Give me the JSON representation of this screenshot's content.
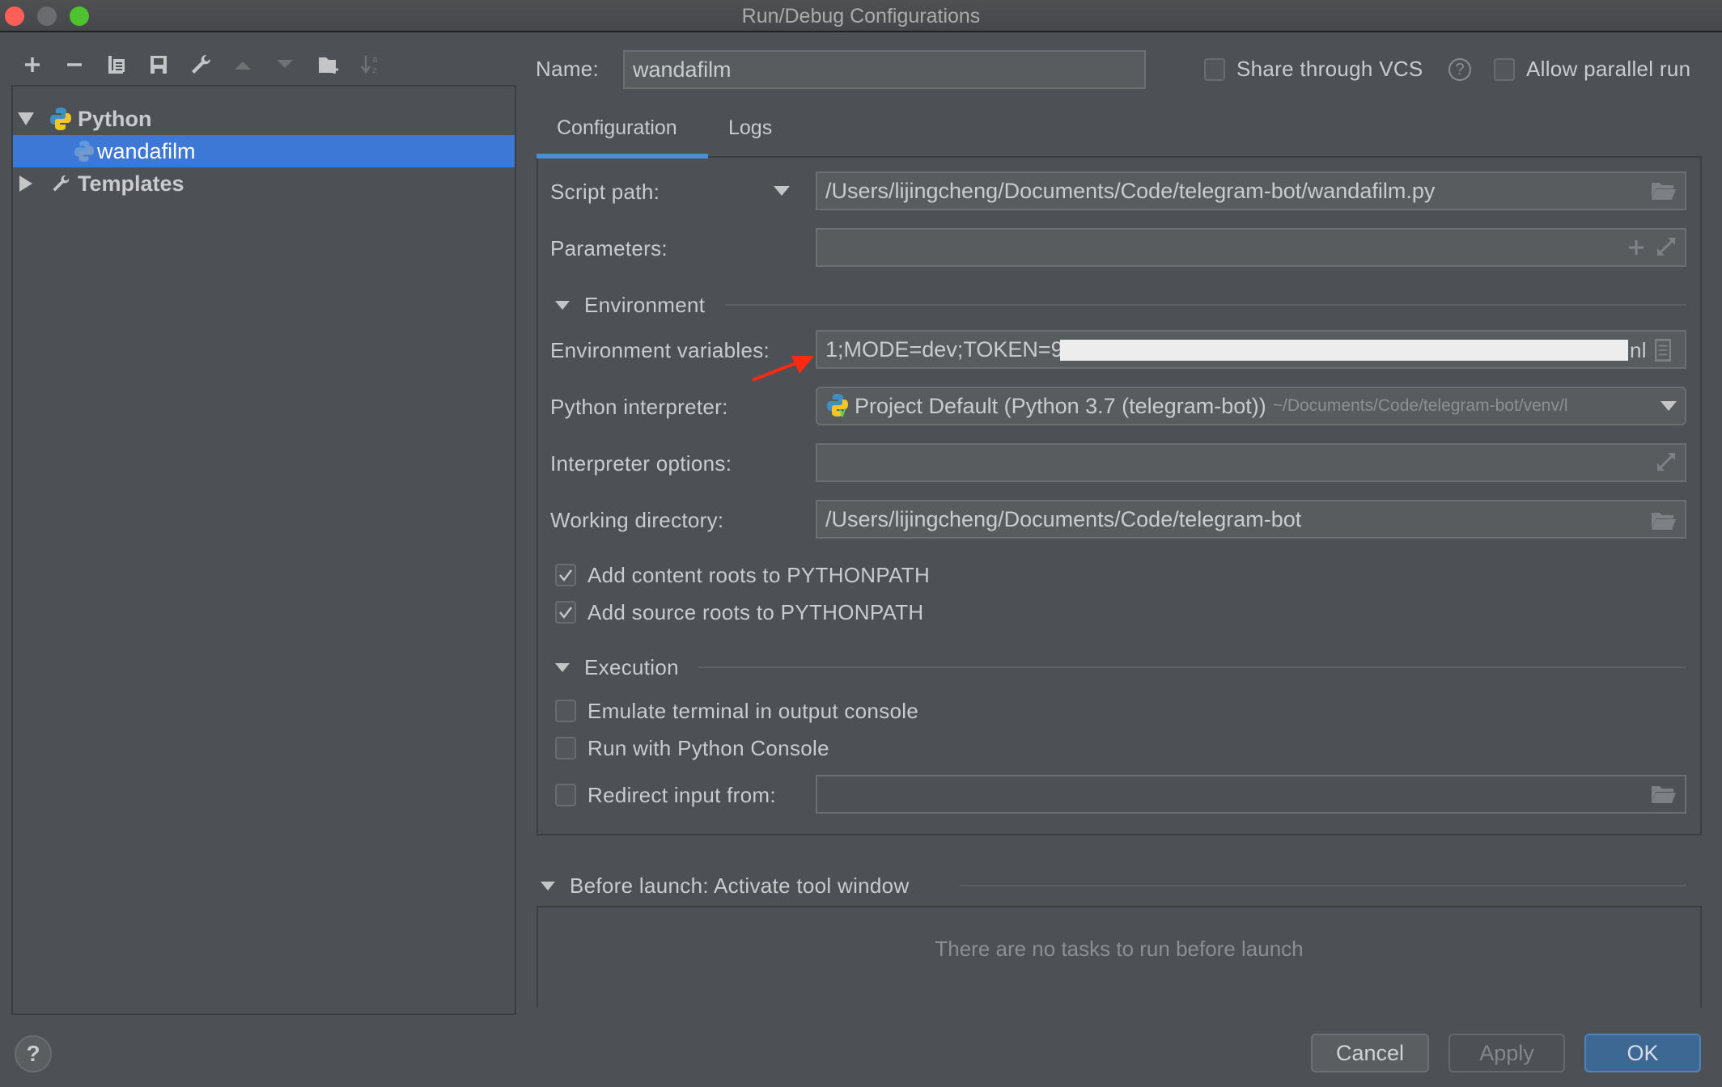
{
  "window": {
    "title": "Run/Debug Configurations",
    "controls": [
      "close",
      "minimize",
      "maximize"
    ]
  },
  "sidebar": {
    "toolbar": [
      {
        "name": "add",
        "icon": "plus-icon",
        "enabled": true
      },
      {
        "name": "remove",
        "icon": "minus-icon",
        "enabled": true
      },
      {
        "name": "copy",
        "icon": "copy-icon",
        "enabled": true
      },
      {
        "name": "save",
        "icon": "save-icon",
        "enabled": true
      },
      {
        "name": "edit-defaults",
        "icon": "wrench-icon",
        "enabled": true
      },
      {
        "name": "move-up",
        "icon": "arrow-up-icon",
        "enabled": false
      },
      {
        "name": "move-down",
        "icon": "arrow-down-icon",
        "enabled": false
      },
      {
        "name": "new-folder",
        "icon": "folder-add-icon",
        "enabled": true
      },
      {
        "name": "sort",
        "icon": "sort-alpha-icon",
        "enabled": false
      }
    ],
    "tree": [
      {
        "label": "Python",
        "expanded": true,
        "icon": "python-icon",
        "level": 0
      },
      {
        "label": "wandafilm",
        "selected": true,
        "icon": "python-run-icon",
        "level": 1
      },
      {
        "label": "Templates",
        "expanded": false,
        "icon": "wrench-icon",
        "level": 0
      }
    ]
  },
  "header": {
    "name_label": "Name:",
    "name_value": "wandafilm",
    "share_vcs_label": "Share through VCS",
    "share_vcs_checked": false,
    "help_glyph": "?",
    "allow_parallel_label": "Allow parallel run",
    "allow_parallel_checked": false
  },
  "tabs": [
    {
      "label": "Configuration",
      "active": true
    },
    {
      "label": "Logs",
      "active": false
    }
  ],
  "config": {
    "script_path_label": "Script path:",
    "script_path_value": "/Users/lijingcheng/Documents/Code/telegram-bot/wandafilm.py",
    "parameters_label": "Parameters:",
    "parameters_value": "",
    "environment_section": "Environment",
    "env_vars_label": "Environment variables:",
    "env_vars_value": "1;MODE=dev;TOKEN=9",
    "env_vars_tail": "nl",
    "python_interpreter_label": "Python interpreter:",
    "python_interpreter_value": "Project Default (Python 3.7 (telegram-bot))",
    "python_interpreter_path": "~/Documents/Code/telegram-bot/venv/l",
    "interpreter_options_label": "Interpreter options:",
    "interpreter_options_value": "",
    "working_dir_label": "Working directory:",
    "working_dir_value": "/Users/lijingcheng/Documents/Code/telegram-bot",
    "add_content_roots_label": "Add content roots to PYTHONPATH",
    "add_content_roots_checked": true,
    "add_source_roots_label": "Add source roots to PYTHONPATH",
    "add_source_roots_checked": true,
    "execution_section": "Execution",
    "emulate_terminal_label": "Emulate terminal in output console",
    "emulate_terminal_checked": false,
    "run_python_console_label": "Run with Python Console",
    "run_python_console_checked": false,
    "redirect_input_label": "Redirect input from:",
    "redirect_input_checked": false,
    "redirect_input_value": ""
  },
  "before_launch": {
    "title": "Before launch: Activate tool window",
    "empty_text": "There are no tasks to run before launch"
  },
  "footer": {
    "help_glyph": "?",
    "cancel_label": "Cancel",
    "apply_label": "Apply",
    "apply_enabled": false,
    "ok_label": "OK"
  },
  "colors": {
    "background": "#4d5054",
    "selection": "#3d78d6",
    "tab_underline": "#4a8fd3",
    "ok_button": "#3d6894",
    "annotation_arrow": "#ff2a12"
  }
}
